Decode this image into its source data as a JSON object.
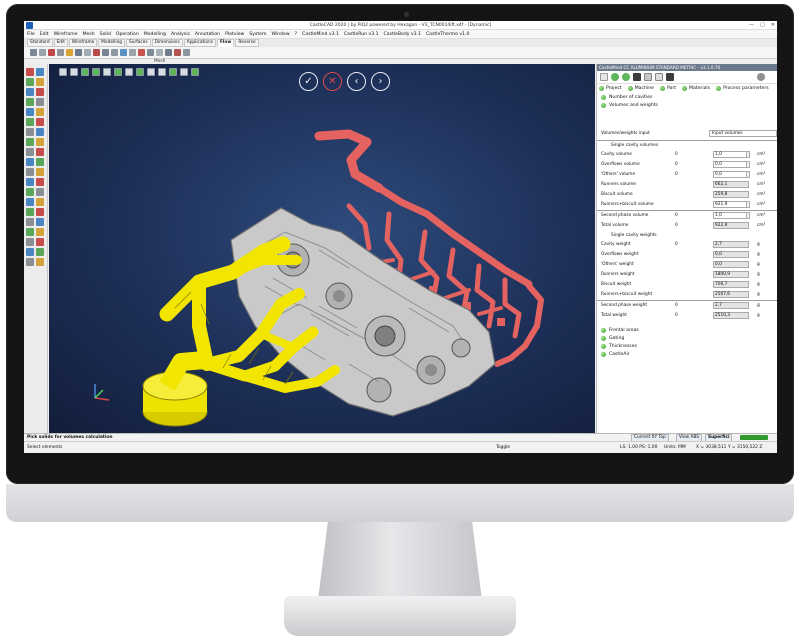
{
  "window": {
    "title": "CastleCAD 2020 | by PiQ2 powered by Hexagon - V3_TCN0014ift.x4f - [Dynamic]",
    "controls": [
      "—",
      "□",
      "✕"
    ]
  },
  "menu": [
    "File",
    "Edit",
    "Wireframe",
    "Mesh",
    "Solid",
    "Operation",
    "Modelling",
    "Analysis",
    "Annotation",
    "Plotview",
    "System",
    "Window",
    "?",
    "CastleMind v3.1",
    "CastleRun v3.1",
    "CastleBody v3.1",
    "CastleThermo v1.0"
  ],
  "ribbon_tabs": [
    "Standard",
    "Edit",
    "Wireframe",
    "Modelling",
    "Surfaces",
    "Dimensions",
    "Applications",
    "Flow",
    "Reverse"
  ],
  "ribbon_active": "Flow",
  "toolbar_group_label": "Mesh",
  "viewport": {
    "nav_buttons": {
      "confirm": "✓",
      "cancel": "✕",
      "prev": "‹",
      "next": "›"
    }
  },
  "panel": {
    "header": "CastleMind CC ALUMINIUM STANDARD METRIC - v3.1.0.70",
    "tabs": [
      "Project",
      "Machine",
      "Part",
      "Materials",
      "Process parameters"
    ],
    "sections": [
      "Number of cavities",
      "Volumes and weights"
    ],
    "input_label": "Volumes/weights input",
    "input_value": "Input volumes",
    "single_cavity_volumes_label": "Single cavity volumes",
    "single_cavity_weights_label": "Single cavity weights",
    "rows": {
      "cavity_volume": {
        "label": "Cavity volume",
        "zero": "0",
        "value": "1,0",
        "unit": "cm³"
      },
      "overflows_volume": {
        "label": "Overflows volume",
        "zero": "0",
        "value": "0,0",
        "unit": "cm³"
      },
      "others_volume": {
        "label": "'Others' volume",
        "zero": "0",
        "value": "0,0",
        "unit": "cm³"
      },
      "runners_volume": {
        "label": "Runners volume",
        "value": "662,1",
        "unit": "cm³"
      },
      "biscuit_volume": {
        "label": "Biscuit volume",
        "value": "259,8",
        "unit": "cm³"
      },
      "runners_biscuit_volume": {
        "label": "Runners+biscuit volume",
        "value": "921,9",
        "unit": "cm³"
      },
      "second_phase_volume": {
        "label": "Second phase volume",
        "zero": "0",
        "value": "1,0",
        "unit": "cm³"
      },
      "total_volume": {
        "label": "Total volume",
        "zero": "0",
        "value": "922,9",
        "unit": "cm³"
      },
      "cavity_weight": {
        "label": "Cavity weight",
        "zero": "0",
        "value": "2,7",
        "unit": "g"
      },
      "overflows_weight": {
        "label": "Overflows weight",
        "value": "0,0",
        "unit": "g"
      },
      "others_weight": {
        "label": "'Others' weight",
        "value": "0,0",
        "unit": "g"
      },
      "runners_weight": {
        "label": "Runners weight",
        "value": "1800,9",
        "unit": "g"
      },
      "biscuit_weight": {
        "label": "Biscuit weight",
        "value": "706,7",
        "unit": "g"
      },
      "runners_biscuit_weight": {
        "label": "Runners+biscuit weight",
        "value": "2507,6",
        "unit": "g"
      },
      "second_phase_weight": {
        "label": "Second phase weight",
        "zero": "0",
        "value": "2,7",
        "unit": "g"
      },
      "total_weight": {
        "label": "Total weight",
        "zero": "0",
        "value": "2510,3",
        "unit": "g"
      }
    },
    "bottom_items": [
      "Frontal areas",
      "Gating",
      "Thicknesses",
      "CastleAir"
    ]
  },
  "status": {
    "prompt": "Pick solids for volumes calculation",
    "select": "Select elements",
    "toggle": "Toggle",
    "current_xy_top": "Current XY Top",
    "view_abs": "View ABS",
    "superficial": "Superfici",
    "ls_ps": "LS: 1.00 PS: 1.00",
    "units": "Units: MM",
    "coords": "X = 3038,511 Y = 3150,522 Z"
  },
  "colors": {
    "viewport_bg": "#1d2f57",
    "part": "#c9c9c9",
    "runners_yellow": "#f2e600",
    "overflow_red": "#e4625f",
    "panel_header": "#6b7a8c",
    "status_green": "#2f9a2e"
  }
}
